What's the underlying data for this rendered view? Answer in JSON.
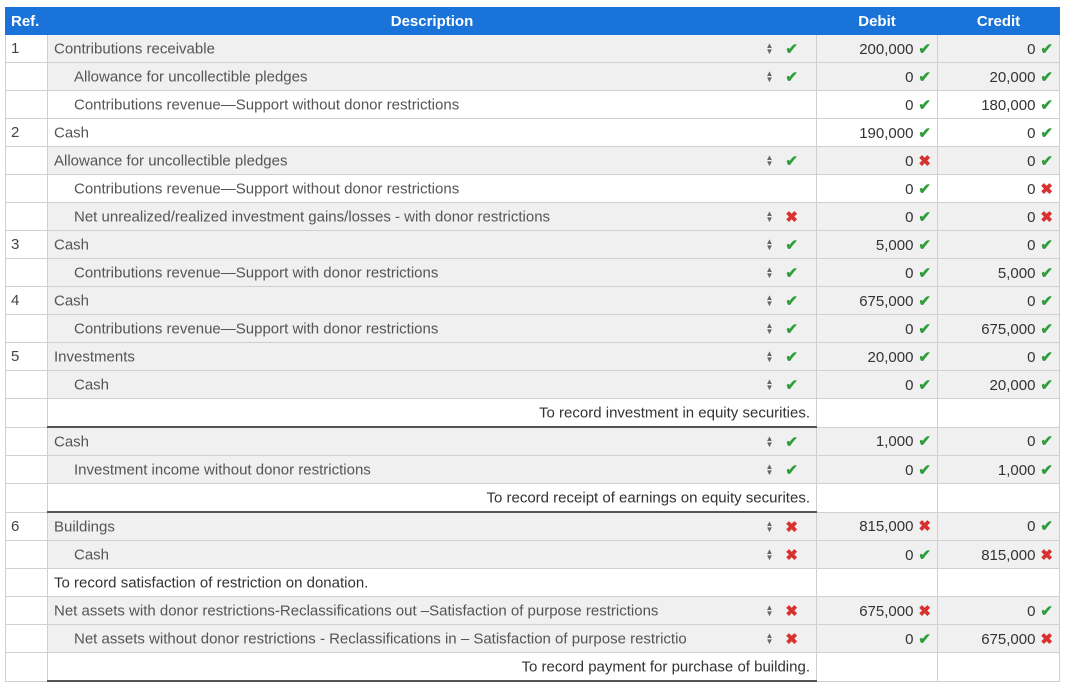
{
  "header": {
    "ref": "Ref.",
    "description": "Description",
    "debit": "Debit",
    "credit": "Credit"
  },
  "rows": [
    {
      "ref": "1",
      "desc": "Contributions receivable",
      "ind": false,
      "sel": true,
      "check": "ok",
      "debit": "200,000",
      "dm": "ok",
      "credit": "0",
      "cm": "ok",
      "g": true
    },
    {
      "ref": "",
      "desc": "Allowance for uncollectible pledges",
      "ind": true,
      "sel": true,
      "check": "ok",
      "debit": "0",
      "dm": "ok",
      "credit": "20,000",
      "cm": "ok",
      "g": true
    },
    {
      "ref": "",
      "desc": "Contributions revenue—Support without donor restrictions",
      "ind": true,
      "sel": false,
      "check": "",
      "debit": "0",
      "dm": "ok",
      "credit": "180,000",
      "cm": "ok",
      "g": false
    },
    {
      "ref": "2",
      "desc": "Cash",
      "ind": false,
      "sel": false,
      "check": "",
      "debit": "190,000",
      "dm": "ok",
      "credit": "0",
      "cm": "ok",
      "g": false
    },
    {
      "ref": "",
      "desc": "Allowance for uncollectible pledges",
      "ind": false,
      "sel": true,
      "check": "ok",
      "debit": "0",
      "dm": "bad",
      "credit": "0",
      "cm": "ok",
      "g": true
    },
    {
      "ref": "",
      "desc": "Contributions revenue—Support without donor restrictions",
      "ind": true,
      "sel": false,
      "check": "",
      "debit": "0",
      "dm": "ok",
      "credit": "0",
      "cm": "bad",
      "g": false
    },
    {
      "ref": "",
      "desc": "Net unrealized/realized investment gains/losses - with donor restrictions",
      "ind": true,
      "sel": true,
      "check": "bad",
      "debit": "0",
      "dm": "ok",
      "credit": "0",
      "cm": "bad",
      "g": true
    },
    {
      "ref": "3",
      "desc": "Cash",
      "ind": false,
      "sel": true,
      "check": "ok",
      "debit": "5,000",
      "dm": "ok",
      "credit": "0",
      "cm": "ok",
      "g": true
    },
    {
      "ref": "",
      "desc": "Contributions revenue—Support with donor restrictions",
      "ind": true,
      "sel": true,
      "check": "ok",
      "debit": "0",
      "dm": "ok",
      "credit": "5,000",
      "cm": "ok",
      "g": true
    },
    {
      "ref": "4",
      "desc": "Cash",
      "ind": false,
      "sel": true,
      "check": "ok",
      "debit": "675,000",
      "dm": "ok",
      "credit": "0",
      "cm": "ok",
      "g": true
    },
    {
      "ref": "",
      "desc": "Contributions revenue—Support with donor restrictions",
      "ind": true,
      "sel": true,
      "check": "ok",
      "debit": "0",
      "dm": "ok",
      "credit": "675,000",
      "cm": "ok",
      "g": true
    },
    {
      "ref": "5",
      "desc": "Investments",
      "ind": false,
      "sel": true,
      "check": "ok",
      "debit": "20,000",
      "dm": "ok",
      "credit": "0",
      "cm": "ok",
      "g": true
    },
    {
      "ref": "",
      "desc": "Cash",
      "ind": true,
      "sel": true,
      "check": "ok",
      "debit": "0",
      "dm": "ok",
      "credit": "20,000",
      "cm": "ok",
      "g": true
    },
    {
      "ref": "",
      "memo": "To record investment in equity securities.",
      "memoAlign": "right"
    },
    {
      "ref": "",
      "desc": "Cash",
      "ind": false,
      "sel": true,
      "check": "ok",
      "debit": "1,000",
      "dm": "ok",
      "credit": "0",
      "cm": "ok",
      "g": true
    },
    {
      "ref": "",
      "desc": "Investment income without donor restrictions",
      "ind": true,
      "sel": true,
      "check": "ok",
      "debit": "0",
      "dm": "ok",
      "credit": "1,000",
      "cm": "ok",
      "g": true
    },
    {
      "ref": "",
      "memo": "To record receipt of earnings on equity securites.",
      "memoAlign": "right"
    },
    {
      "ref": "6",
      "desc": "Buildings",
      "ind": false,
      "sel": true,
      "check": "bad",
      "debit": "815,000",
      "dm": "bad",
      "credit": "0",
      "cm": "ok",
      "g": true
    },
    {
      "ref": "",
      "desc": "Cash",
      "ind": true,
      "sel": true,
      "check": "bad",
      "debit": "0",
      "dm": "ok",
      "credit": "815,000",
      "cm": "bad",
      "g": true
    },
    {
      "ref": "",
      "memo": "To record satisfaction of restriction on donation.",
      "memoAlign": "left"
    },
    {
      "ref": "",
      "desc": "Net assets with donor restrictions-Reclassifications out –Satisfaction of purpose restrictions",
      "ind": false,
      "sel": true,
      "check": "bad",
      "debit": "675,000",
      "dm": "bad",
      "credit": "0",
      "cm": "ok",
      "g": true
    },
    {
      "ref": "",
      "desc": "Net assets without donor restrictions - Reclassifications in – Satisfaction of purpose restrictio",
      "ind": true,
      "sel": true,
      "check": "bad",
      "debit": "0",
      "dm": "ok",
      "credit": "675,000",
      "cm": "bad",
      "g": true
    },
    {
      "ref": "",
      "memo": "To record payment for purchase of building.",
      "memoAlign": "right"
    }
  ],
  "icons": {
    "ok": "check-icon",
    "bad": "cross-icon",
    "sort": "sort-arrows-icon"
  },
  "colors": {
    "header": "#1a73d9",
    "ok": "#2e9e3b",
    "bad": "#d93030"
  }
}
